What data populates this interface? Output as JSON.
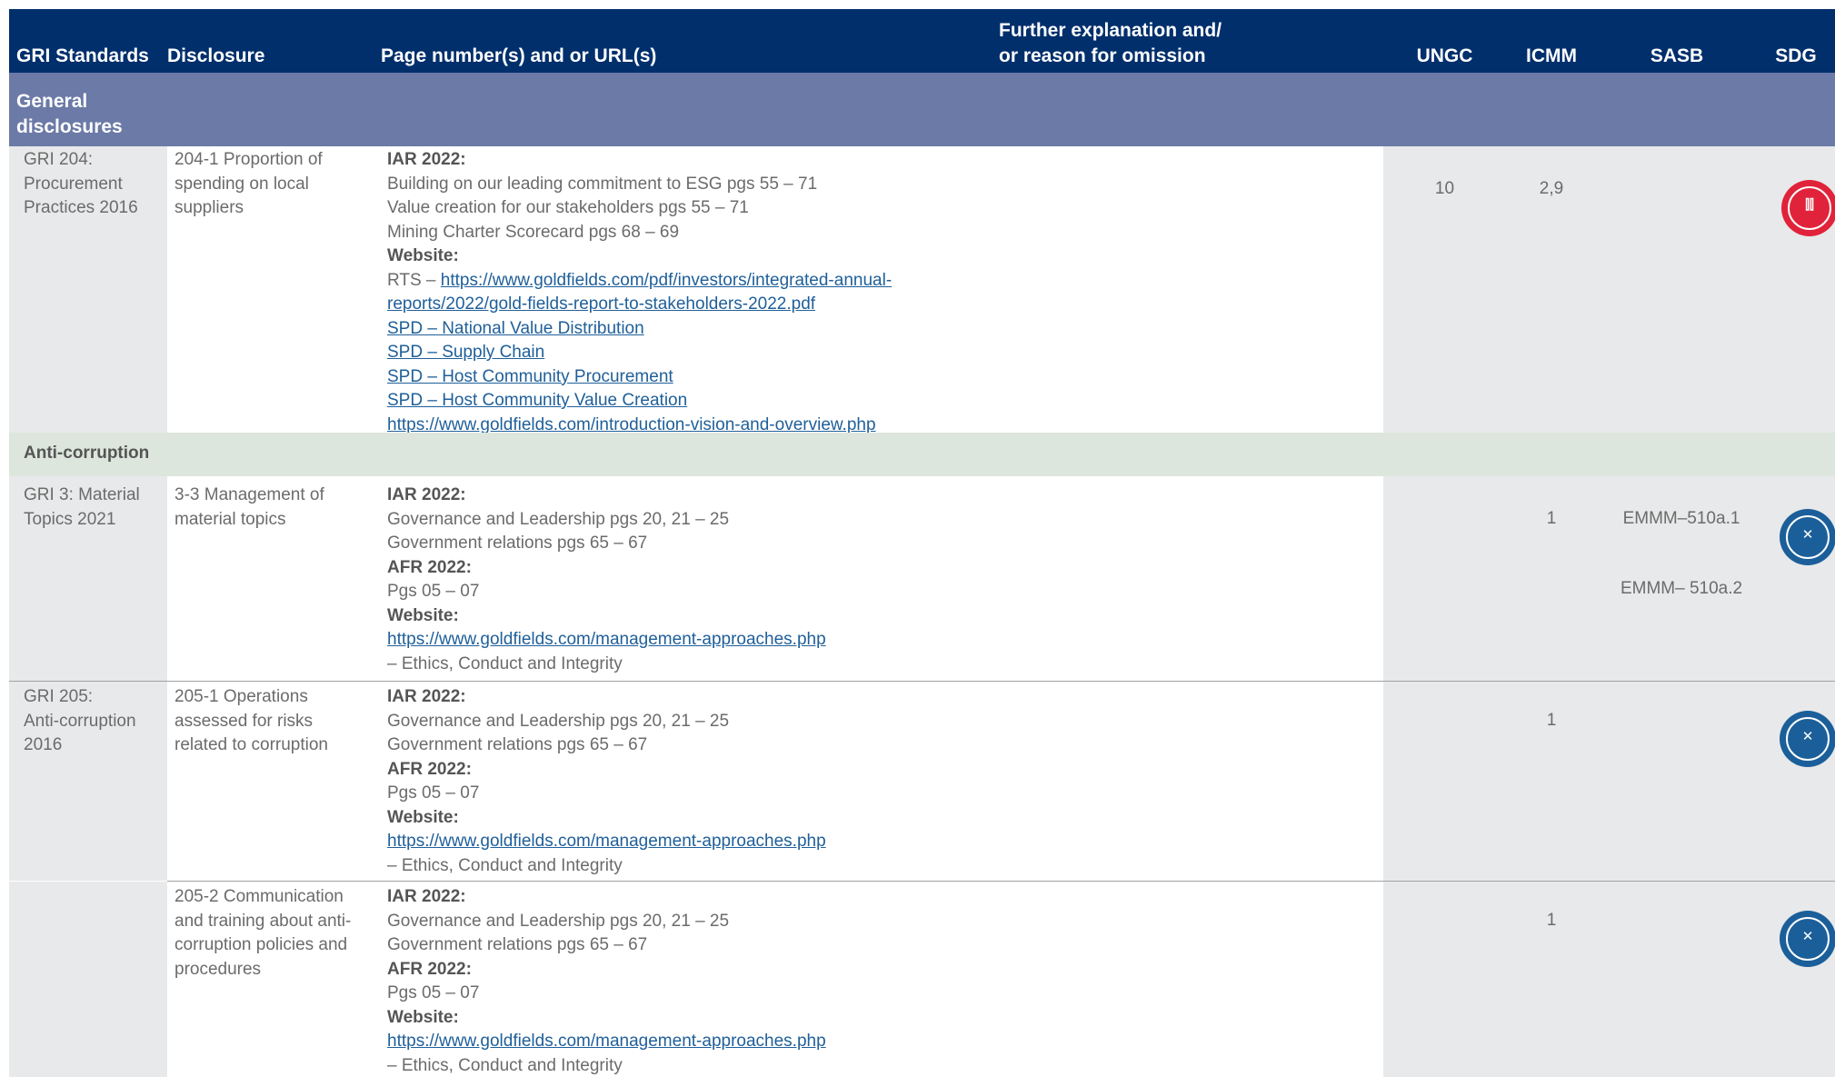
{
  "header": {
    "gri": "GRI Standards",
    "disclosure": "Disclosure",
    "page": "Page number(s) and or URL(s)",
    "further_1": "Further explanation and/",
    "further_2": "or reason for omission",
    "ungc": "UNGC",
    "icmm": "ICMM",
    "sasb": "SASB",
    "sdg": "SDG"
  },
  "section_general": "General disclosures",
  "section_anti": "Anti-corruption",
  "rows": [
    {
      "standard": [
        "GRI 204:",
        "Procurement",
        "Practices 2016"
      ],
      "disclosure": [
        "204-1 Proportion of",
        "spending on local",
        "suppliers"
      ],
      "lines": [
        {
          "text": "IAR 2022:",
          "style": "bold"
        },
        {
          "text": "Building on our leading commitment to ESG pgs 55 – 71",
          "style": "normal"
        },
        {
          "text": "Value creation for our stakeholders pgs 55 – 71",
          "style": "normal"
        },
        {
          "text": "Mining Charter Scorecard pgs 68 – 69",
          "style": "normal"
        },
        {
          "text": "Website:",
          "style": "bold"
        },
        {
          "text": "RTS – ",
          "style": "normal",
          "link": "https://www.goldfields.com/pdf/investors/integrated-annual-"
        },
        {
          "text": "reports/2022/gold-fields-report-to-stakeholders-2022.pdf",
          "style": "link"
        },
        {
          "text": "SPD – National Value Distribution",
          "style": "link"
        },
        {
          "text": "SPD – Supply Chain",
          "style": "link"
        },
        {
          "text": "SPD – Host Community Procurement",
          "style": "link"
        },
        {
          "text": "SPD – Host Community Value Creation",
          "style": "link"
        },
        {
          "text": "https://www.goldfields.com/introduction-vision-and-overview.php",
          "style": "link"
        }
      ],
      "ungc": "10",
      "icmm": "2,9",
      "sasb": [
        "",
        ""
      ],
      "sdg_icon": "sdg-goal-8-icon",
      "sdg_color": "#e0233a"
    },
    {
      "standard": [
        "GRI 3: Material",
        "Topics 2021"
      ],
      "disclosure": [
        "3-3 Management of",
        "material topics"
      ],
      "lines": [
        {
          "text": "IAR 2022:",
          "style": "bold"
        },
        {
          "text": "Governance and Leadership pgs 20, 21 – 25",
          "style": "normal"
        },
        {
          "text": "Government relations pgs 65 – 67",
          "style": "normal"
        },
        {
          "text": "AFR 2022:",
          "style": "bold"
        },
        {
          "text": "Pgs 05 – 07",
          "style": "normal"
        },
        {
          "text": "Website:",
          "style": "bold"
        },
        {
          "text": "https://www.goldfields.com/management-approaches.php",
          "style": "link"
        },
        {
          "text": "– Ethics, Conduct and Integrity",
          "style": "normal"
        }
      ],
      "ungc": "",
      "icmm": "1",
      "sasb": [
        "EMMM–510a.1",
        "EMMM– 510a.2"
      ],
      "sdg_icon": "sdg-goal-16-icon",
      "sdg_color": "#1b5f9a"
    },
    {
      "standard": [
        "GRI 205:",
        "Anti-corruption",
        "2016"
      ],
      "disclosure": [
        "205-1 Operations",
        "assessed for risks",
        "related to corruption"
      ],
      "lines": [
        {
          "text": "IAR 2022:",
          "style": "bold"
        },
        {
          "text": "Governance and Leadership pgs 20, 21 – 25",
          "style": "normal"
        },
        {
          "text": "Government relations pgs 65 – 67",
          "style": "normal"
        },
        {
          "text": "AFR 2022:",
          "style": "bold"
        },
        {
          "text": "Pgs 05 – 07",
          "style": "normal"
        },
        {
          "text": "Website:",
          "style": "bold"
        },
        {
          "text": "https://www.goldfields.com/management-approaches.php",
          "style": "link"
        },
        {
          "text": "– Ethics, Conduct and Integrity",
          "style": "normal"
        }
      ],
      "ungc": "",
      "icmm": "1",
      "sasb": [
        "",
        ""
      ],
      "sdg_icon": "sdg-goal-16-icon",
      "sdg_color": "#1b5f9a"
    },
    {
      "standard": [
        "",
        "",
        ""
      ],
      "disclosure": [
        "205-2 Communication",
        "and training about anti-",
        "corruption policies and",
        "procedures"
      ],
      "lines": [
        {
          "text": "IAR 2022:",
          "style": "bold"
        },
        {
          "text": "Governance and Leadership pgs 20, 21 – 25",
          "style": "normal"
        },
        {
          "text": "Government relations pgs 65 – 67",
          "style": "normal"
        },
        {
          "text": "AFR 2022:",
          "style": "bold"
        },
        {
          "text": "Pgs 05 – 07",
          "style": "normal"
        },
        {
          "text": "Website:",
          "style": "bold"
        },
        {
          "text": "https://www.goldfields.com/management-approaches.php",
          "style": "link"
        },
        {
          "text": "– Ethics, Conduct and Integrity",
          "style": "normal"
        }
      ],
      "ungc": "",
      "icmm": "1",
      "sasb": [
        "",
        ""
      ],
      "sdg_icon": "sdg-goal-16-icon",
      "sdg_color": "#1b5f9a"
    }
  ]
}
